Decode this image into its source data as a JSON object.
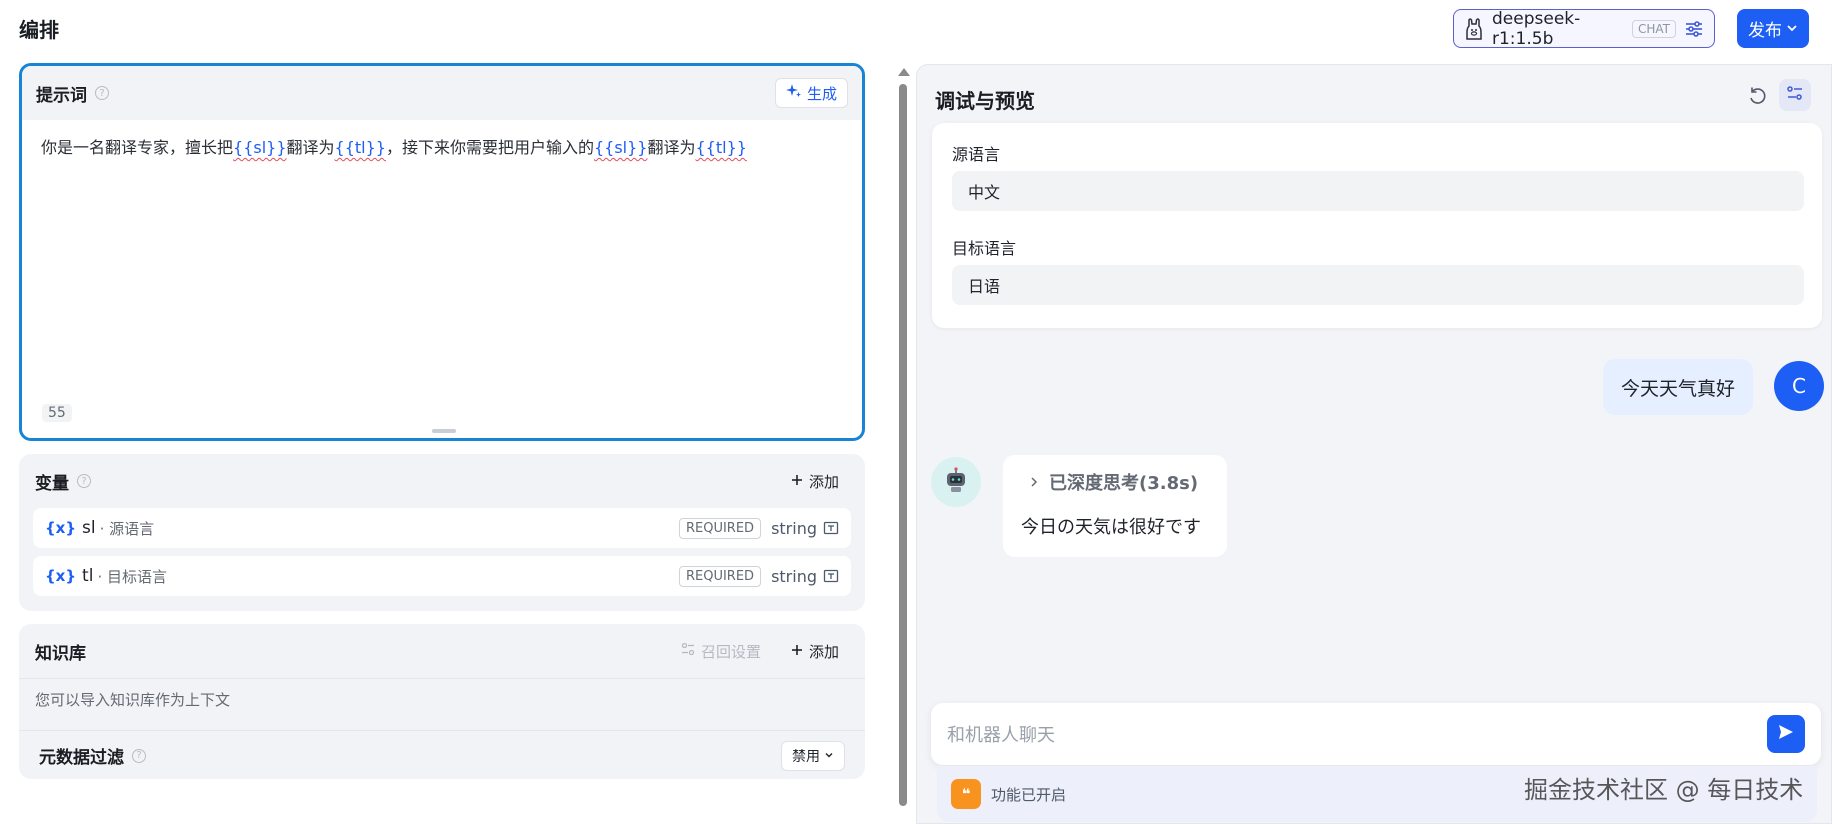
{
  "header": {
    "title": "编排",
    "model": {
      "name": "deepseek-r1:1.5b",
      "tag": "CHAT"
    },
    "publish_label": "发布"
  },
  "prompt": {
    "title": "提示词",
    "generate_label": "生成",
    "text_parts": [
      "你是一名翻译专家，擅长把",
      "{{sl}}",
      "翻译为",
      "{{tl}}",
      "，接下来你需要把用户输入的",
      "{{sl}}",
      "翻译为",
      "{{tl}}"
    ],
    "char_count": "55"
  },
  "variables": {
    "title": "变量",
    "add_label": "添加",
    "items": [
      {
        "symbol": "{x}",
        "key": "sl",
        "desc": "· 源语言",
        "badge": "REQUIRED",
        "type": "string"
      },
      {
        "symbol": "{x}",
        "key": "tl",
        "desc": "· 目标语言",
        "badge": "REQUIRED",
        "type": "string"
      }
    ]
  },
  "knowledge": {
    "title": "知识库",
    "recall_label": "召回设置",
    "add_label": "添加",
    "hint": "您可以导入知识库作为上下文",
    "meta_filter_title": "元数据过滤",
    "meta_filter_value": "禁用"
  },
  "preview": {
    "title": "调试与预览",
    "fields": [
      {
        "label": "源语言",
        "value": "中文"
      },
      {
        "label": "目标语言",
        "value": "日语"
      }
    ],
    "user_message": "今天天气真好",
    "user_initial": "C",
    "thinking_label": "已深度思考(3.8s)",
    "bot_message": "今日の天気は很好です",
    "input_placeholder": "和机器人聊天",
    "feature_text": "功能已开启",
    "feature_icon_glyph": "❝"
  },
  "watermark": "掘金技术社区 @ 每日技术",
  "colors": {
    "accent": "#1d5ef5",
    "prompt_border": "#1784d6",
    "panel_bg": "#f3f4f8"
  }
}
